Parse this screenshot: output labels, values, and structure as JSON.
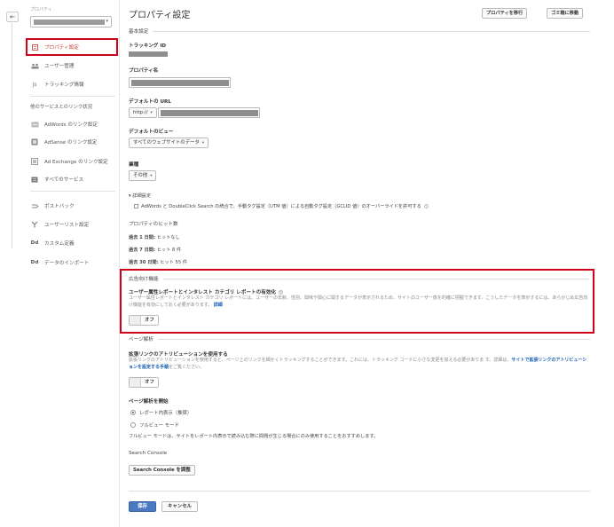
{
  "nav_back_icon": "arrow-left-icon",
  "sidebar": {
    "property_label": "プロパティ",
    "items": [
      {
        "label": "プロパティ設定",
        "icon": "property-settings-icon"
      },
      {
        "label": "ユーザー管理",
        "icon": "users-icon"
      },
      {
        "label": "トラッキング情報",
        "icon": "tracking-code-icon"
      }
    ],
    "product_linking_header": "他のサービスとのリンク状況",
    "product_links": [
      {
        "label": "AdWords のリンク設定",
        "icon": "adwords-icon"
      },
      {
        "label": "AdSense のリンク設定",
        "icon": "adsense-icon"
      },
      {
        "label": "Ad Exchange のリンク設定",
        "icon": "ad-exchange-icon"
      },
      {
        "label": "すべてのサービス",
        "icon": "all-products-icon"
      }
    ],
    "other_items": [
      {
        "label": "ポストバック",
        "icon": "postback-icon"
      },
      {
        "label": "ユーザーリスト設定",
        "icon": "audience-icon"
      },
      {
        "label": "カスタム定義",
        "icon_text": "Dd"
      },
      {
        "label": "データのインポート",
        "icon_text": "Dd"
      }
    ]
  },
  "main": {
    "title": "プロパティ設定",
    "move_property_button": "プロパティを移行",
    "trash_button": "ゴミ箱に移動",
    "basic_settings": "基本設定",
    "tracking_id_label": "トラッキング ID",
    "property_name_label": "プロパティ名",
    "default_url_label": "デフォルトの URL",
    "protocol": "http://",
    "default_view_label": "デフォルトのビュー",
    "default_view_value": "すべてのウェブサイトのデータ",
    "industry_label": "業種",
    "industry_value": "その他",
    "advanced_label": "▾ 詳細設定",
    "auto_tagging_text": "AdWords と DoubleClick Search の統合で、手動タグ設定（UTM 値）による自動タグ設定（GCLID 値）のオーバーライドを許可する",
    "hits_title": "プロパティのヒット数",
    "hits": [
      {
        "period": "過去 1 日間:",
        "value": "ヒットなし"
      },
      {
        "period": "過去 7 日間:",
        "value": "ヒット 8 件"
      },
      {
        "period": "過去 30 日間:",
        "value": "ヒット 55 件"
      }
    ],
    "advertising_features": "広告向け機能",
    "demographics_title": "ユーザー属性レポートとインタレスト カテゴリ レポートの有効化",
    "demographics_desc": "ユーザー属性レポートとインタレスト カテゴリ レポートには、ユーザーの年齢、性別、興味や関心に関するデータが表示されるため、サイトのユーザー像を的確に把握できます。こうしたデータを表示するには、あらかじめ広告向け機能を有効にしておく必要があります。",
    "demographics_link": "詳細",
    "toggle_off": "オフ",
    "page_analytics": "ページ解析",
    "enhanced_link_title": "拡張リンクのアトリビューションを使用する",
    "enhanced_link_desc": "拡張リンクのアトリビューションを使用すると、ページ上のリンクを細かくトラッキングすることができます。これには、トラッキング コードに小さな変更を加える必要がありま す。詳細は、",
    "enhanced_link_link": "サイトで拡張リンクのアトリビューションを設定する手順",
    "enhanced_link_suffix": "をご覧ください。",
    "page_analytics_start_label": "ページ解析を開始",
    "radio_in_page": "レポート内表示（推奨）",
    "radio_full_view": "フルビュー モード",
    "full_view_note": "フルビュー モードは、サイトをレポート内表示で読み込む際に問題が生じる場合にのみ使用することをおすすめします。",
    "search_console_label": "Search Console",
    "search_console_button": "Search Console を調整",
    "save_button": "保存",
    "cancel_button": "キャンセル"
  },
  "colors": {
    "highlight": "#d0021b",
    "primary": "#4a78c2",
    "link": "#1a5fb4"
  }
}
